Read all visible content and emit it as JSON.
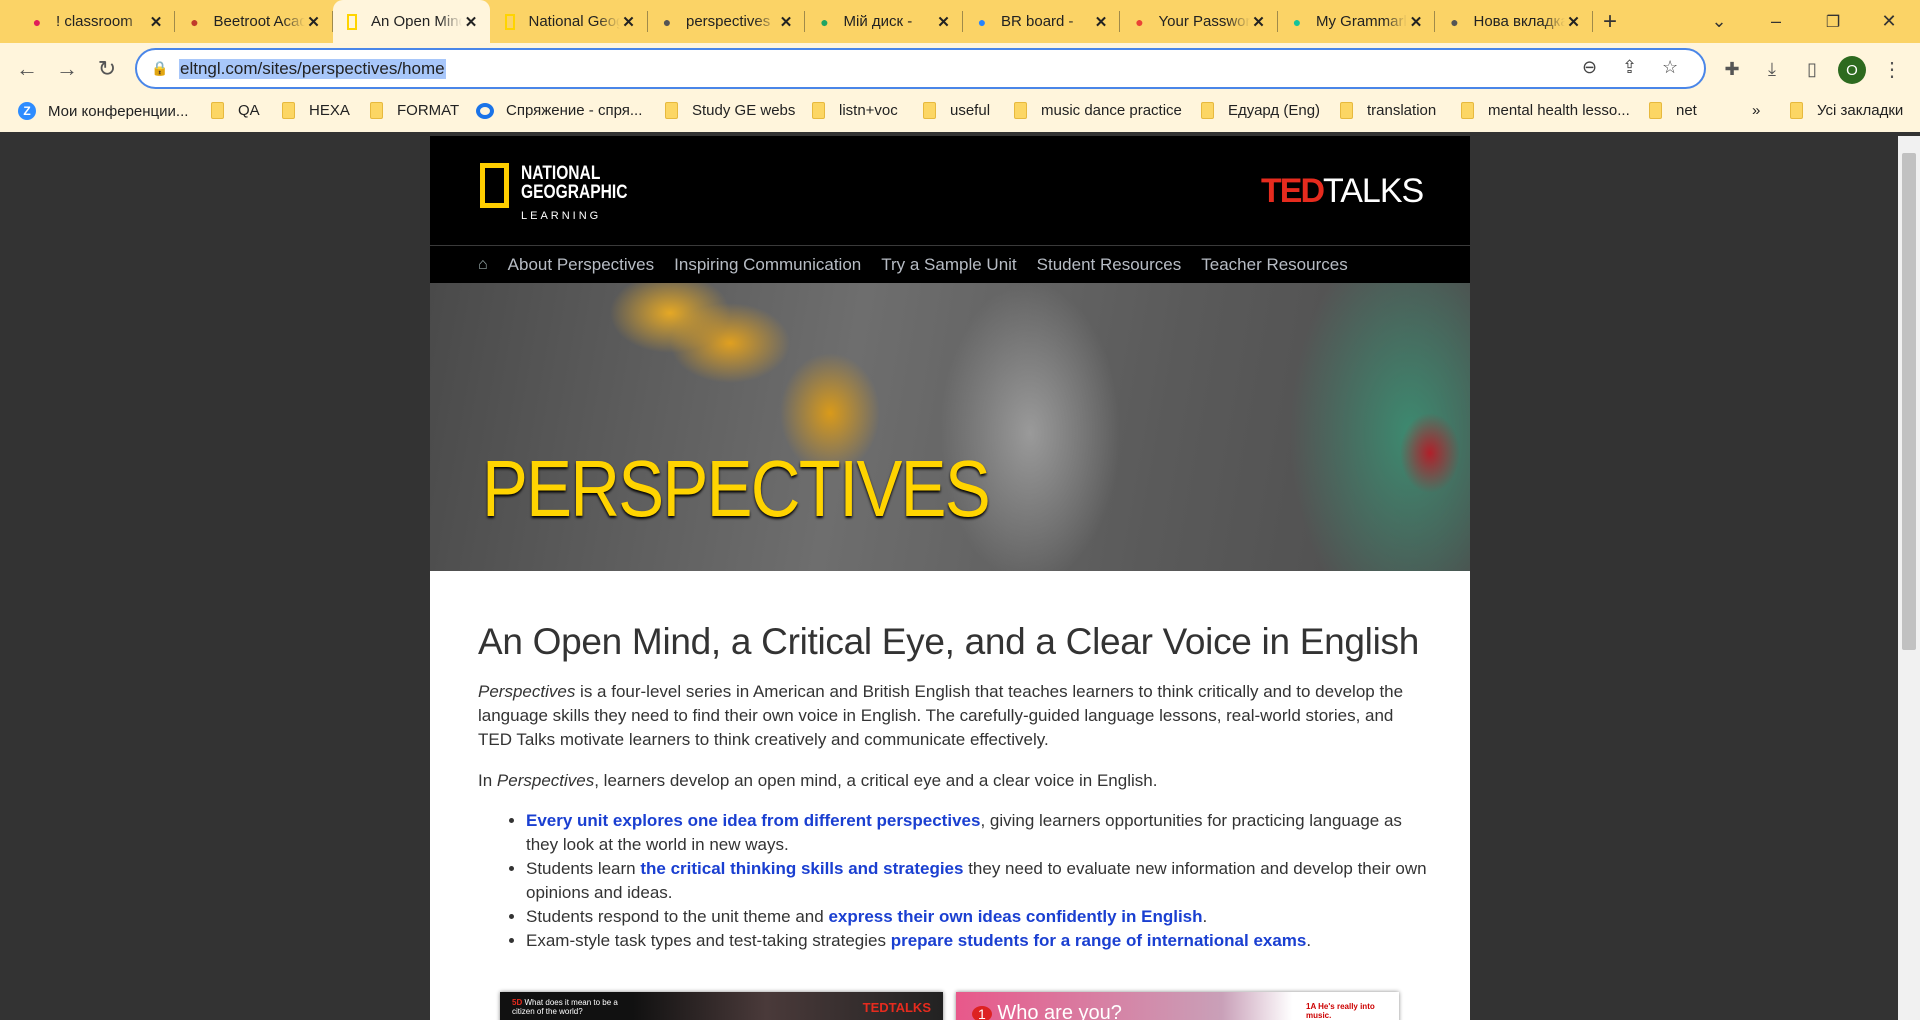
{
  "browser": {
    "tabs": [
      {
        "title": "! classroom",
        "icon": "slack-icon",
        "color": "#e01e5a"
      },
      {
        "title": "Beetroot Academy",
        "icon": "beetroot-icon",
        "color": "#c0392b"
      },
      {
        "title": "An Open Mind",
        "icon": "natgeo-icon",
        "color": "#ffd400",
        "active": true
      },
      {
        "title": "National Geographic",
        "icon": "natgeo-icon",
        "color": "#ffd400"
      },
      {
        "title": "perspectives",
        "icon": "globe-icon",
        "color": "#555"
      },
      {
        "title": "Мій диск -",
        "icon": "google-drive-icon",
        "color": "#1fa463"
      },
      {
        "title": "BR board -",
        "icon": "jira-icon",
        "color": "#2684ff"
      },
      {
        "title": "Your Password",
        "icon": "gmail-icon",
        "color": "#ea4335"
      },
      {
        "title": "My Grammarly",
        "icon": "grammarly-icon",
        "color": "#15c39a"
      },
      {
        "title": "Нова вкладка",
        "icon": "chrome-icon",
        "color": "#555"
      }
    ],
    "url": "eltngl.com/sites/perspectives/home",
    "profile_initial": "O",
    "bookmarks": [
      {
        "label": "Мои конференции...",
        "icon": "zoom-icon"
      },
      {
        "label": "QA",
        "icon": "folder-icon"
      },
      {
        "label": "HEXA",
        "icon": "folder-icon"
      },
      {
        "label": "FORMAT",
        "icon": "folder-icon"
      },
      {
        "label": "Спряжение - спря...",
        "icon": "speech-bubble-icon"
      },
      {
        "label": "Study GE webs",
        "icon": "folder-icon"
      },
      {
        "label": "listn+voc",
        "icon": "folder-icon"
      },
      {
        "label": "useful",
        "icon": "folder-icon"
      },
      {
        "label": "music dance practice",
        "icon": "folder-icon"
      },
      {
        "label": "Едуард (Eng)",
        "icon": "folder-icon"
      },
      {
        "label": "translation",
        "icon": "folder-icon"
      },
      {
        "label": "mental health lesso...",
        "icon": "folder-icon"
      },
      {
        "label": "net",
        "icon": "folder-icon"
      }
    ],
    "more_bookmarks": "»",
    "all_bookmarks": "Усі закладки"
  },
  "site": {
    "logo_ng": "NATIONAL GEOGRAPHIC",
    "logo_ng_sub": "LEARNING",
    "logo_ted": "TED",
    "logo_talks": "TALKS",
    "nav": [
      "About Perspectives",
      "Inspiring Communication",
      "Try a Sample Unit",
      "Student Resources",
      "Teacher Resources"
    ],
    "hero_title": "PERSPECTIVES",
    "heading": "An Open Mind, a Critical Eye, and a Clear Voice in English",
    "p1_em": "Perspectives",
    "p1_rest": " is a four-level series in American and British English that teaches learners to think critically and to develop the language skills they need to find their own voice in English. The carefully-guided language lessons, real-world stories, and TED Talks motivate learners to think creatively and communicate effectively.",
    "p2_pre": "In ",
    "p2_em": "Perspectives",
    "p2_rest": ", learners develop an open mind, a critical eye and a clear voice in English.",
    "bullets": [
      {
        "pre": "",
        "link": "Every unit explores one idea from different perspectives",
        "post": ", giving learners opportunities for practicing language as they look at the world in new ways."
      },
      {
        "pre": "Students learn ",
        "link": "the critical thinking skills and strategies",
        "post": " they need to evaluate new information and develop their own opinions and ideas."
      },
      {
        "pre": "Students respond to the unit theme and ",
        "link": "express their own ideas confidently in English",
        "post": "."
      },
      {
        "pre": "Exam-style task types and test-taking strategies ",
        "link": "prepare students for a range of international exams",
        "post": "."
      }
    ],
    "thumb1_unit": "5D",
    "thumb1_text": "What does it mean to be a citizen of the world?",
    "thumb1_logo": "TEDTALKS",
    "thumb2_num": "1",
    "thumb2_title": "Who are you?",
    "thumb2_side": "1A He's really into music."
  }
}
